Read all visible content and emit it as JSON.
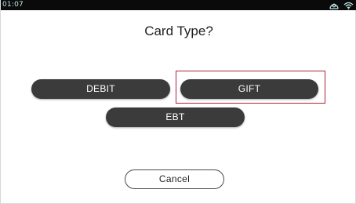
{
  "status_bar": {
    "time": "01:07",
    "icons": [
      "account-circle-icon",
      "wifi-icon"
    ],
    "time_color": "#bfe8e8",
    "background": "#0a0a0a"
  },
  "prompt": {
    "title": "Card Type?"
  },
  "options": [
    {
      "label": "DEBIT"
    },
    {
      "label": "GIFT",
      "highlighted": true
    },
    {
      "label": "EBT"
    }
  ],
  "cancel": {
    "label": "Cancel"
  },
  "colors": {
    "button_fill": "#3b3b3b",
    "button_text": "#ffffff",
    "highlight_border": "#b0213a"
  }
}
